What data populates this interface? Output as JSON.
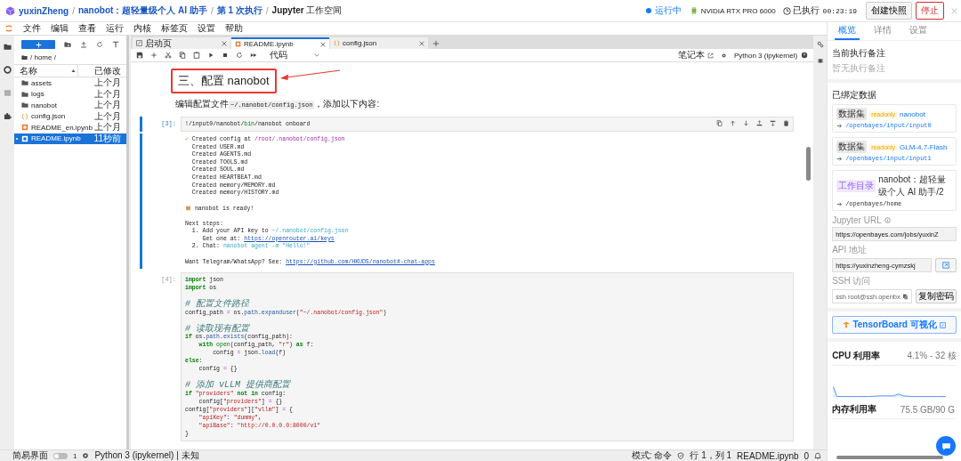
{
  "topbar": {
    "separator": "/",
    "breadcrumbs": [
      {
        "kind": "link",
        "text": "yuxinZheng"
      },
      {
        "kind": "link",
        "text": "nanobot：超轻量级个人 AI 助手"
      },
      {
        "kind": "link",
        "text": "第 1 次执行"
      },
      {
        "kind": "current",
        "text": "**Jupyter** 工作空间"
      }
    ],
    "status": {
      "label": "运行中",
      "running": true
    },
    "gpu": "NVIDIA RTX PRO 6000",
    "elapsed_label": "已执行",
    "elapsed": "00:23:19",
    "buttons": [
      {
        "label": "创建快照",
        "kind": "default"
      },
      {
        "label": "停止",
        "kind": "danger"
      }
    ]
  },
  "menu": [
    "文件",
    "编辑",
    "查看",
    "运行",
    "内核",
    "标签页",
    "设置",
    "帮助"
  ],
  "filebrowser": {
    "path": "/ home /",
    "columns": [
      "名称",
      "已修改"
    ],
    "items": [
      {
        "name": "assets",
        "kind": "folder",
        "modified": "上个月",
        "selected": false,
        "running": false
      },
      {
        "name": "logs",
        "kind": "folder",
        "modified": "上个月",
        "selected": false,
        "running": false
      },
      {
        "name": "nanobot",
        "kind": "folder",
        "modified": "上个月",
        "selected": false,
        "running": false
      },
      {
        "name": "config.json",
        "kind": "json",
        "modified": "上个月",
        "selected": false,
        "running": false
      },
      {
        "name": "README_en.ipynb",
        "kind": "notebook",
        "modified": "上个月",
        "selected": false,
        "running": false
      },
      {
        "name": "README.ipynb",
        "kind": "notebook",
        "modified": "11秒前",
        "selected": true,
        "running": true
      }
    ]
  },
  "notebook": {
    "tabs": [
      {
        "label": "启动页",
        "kind": "launcher",
        "selected": false
      },
      {
        "label": "README.ipynb",
        "kind": "notebook",
        "selected": true
      },
      {
        "label": "config.json",
        "kind": "json",
        "selected": false
      }
    ],
    "cell_type": "代码",
    "notebook_label": "笔记本",
    "kernel": "Python 3 (ipykernel)",
    "cells": [
      {
        "kind": "heading",
        "text": "三、配置 nanobot",
        "highlighted": true
      },
      {
        "kind": "markdown",
        "parts": [
          {
            "kind": "text",
            "text": "编辑配置文件"
          },
          {
            "kind": "code",
            "text": "~/.nanobot/config.json"
          },
          {
            "kind": "text",
            "text": "，添加以下内容:"
          }
        ]
      },
      {
        "kind": "code",
        "prompt": "[3]:",
        "selected": true,
        "lines": [
          {
            "kind": "text",
            "parts": [
              {
                "kind": "plain",
                "text": "!/input0/nanobot/"
              },
              {
                "kind": "builtin",
                "text": "bin"
              },
              {
                "kind": "plain",
                "text": "/nanobot onboard"
              }
            ]
          }
        ],
        "output": [
          {
            "kind": "text",
            "parts": [
              {
                "kind": "check",
                "text": "✓"
              },
              {
                "kind": "plain",
                "text": " Created config at "
              },
              {
                "kind": "path",
                "text": "/root/.nanobot/config.json"
              }
            ]
          },
          {
            "kind": "text",
            "parts": [
              {
                "kind": "plain",
                "text": "  Created USER.md"
              }
            ]
          },
          {
            "kind": "text",
            "parts": [
              {
                "kind": "plain",
                "text": "  Created AGENTS.md"
              }
            ]
          },
          {
            "kind": "text",
            "parts": [
              {
                "kind": "plain",
                "text": "  Created TOOLS.md"
              }
            ]
          },
          {
            "kind": "text",
            "parts": [
              {
                "kind": "plain",
                "text": "  Created SOUL.md"
              }
            ]
          },
          {
            "kind": "text",
            "parts": [
              {
                "kind": "plain",
                "text": "  Created HEARTBEAT.md"
              }
            ]
          },
          {
            "kind": "text",
            "parts": [
              {
                "kind": "plain",
                "text": "  Created memory/MEMORY.md"
              }
            ]
          },
          {
            "kind": "text",
            "parts": [
              {
                "kind": "plain",
                "text": "  Created memory/HISTORY.md"
              }
            ]
          },
          {
            "kind": "blank"
          },
          {
            "kind": "text",
            "parts": [
              {
                "kind": "cat"
              },
              {
                "kind": "plain",
                "text": " nanobot is ready!"
              }
            ]
          },
          {
            "kind": "blank"
          },
          {
            "kind": "text",
            "parts": [
              {
                "kind": "plain",
                "text": "Next steps:"
              }
            ]
          },
          {
            "kind": "text",
            "parts": [
              {
                "kind": "plain",
                "text": "  1. Add your API key to "
              },
              {
                "kind": "cyan",
                "text": "~/.nanobot/config.json"
              }
            ]
          },
          {
            "kind": "text",
            "parts": [
              {
                "kind": "plain",
                "text": "     Get one at: "
              },
              {
                "kind": "link",
                "text": "https://openrouter.ai/keys"
              }
            ]
          },
          {
            "kind": "text",
            "parts": [
              {
                "kind": "plain",
                "text": "  2. Chat: "
              },
              {
                "kind": "cyan",
                "text": "nanobot agent -m \"Hello!\""
              }
            ]
          },
          {
            "kind": "blank"
          },
          {
            "kind": "text",
            "parts": [
              {
                "kind": "plain",
                "text": "Want Telegram/WhatsApp? See: "
              },
              {
                "kind": "link",
                "text": "https://github.com/HKUDS/nanobot#-chat-apps"
              }
            ]
          }
        ]
      },
      {
        "kind": "code",
        "prompt": "[4]:",
        "selected": false,
        "lines": [
          {
            "kind": "text",
            "parts": [
              {
                "kind": "keyword",
                "text": "import"
              },
              {
                "kind": "plain",
                "text": " json"
              }
            ]
          },
          {
            "kind": "text",
            "parts": [
              {
                "kind": "keyword",
                "text": "import"
              },
              {
                "kind": "plain",
                "text": " os"
              }
            ]
          },
          {
            "kind": "blank"
          },
          {
            "kind": "text",
            "parts": [
              {
                "kind": "comment",
                "text": "# 配置文件路径"
              }
            ]
          },
          {
            "kind": "text",
            "parts": [
              {
                "kind": "plain",
                "text": "config_path "
              },
              {
                "kind": "op",
                "text": "="
              },
              {
                "kind": "plain",
                "text": " os."
              },
              {
                "kind": "attr",
                "text": "path"
              },
              {
                "kind": "plain",
                "text": "."
              },
              {
                "kind": "attr",
                "text": "expanduser"
              },
              {
                "kind": "plain",
                "text": "("
              },
              {
                "kind": "string",
                "text": "\"~/.nanobot/config.json\""
              },
              {
                "kind": "plain",
                "text": ")"
              }
            ]
          },
          {
            "kind": "blank"
          },
          {
            "kind": "text",
            "parts": [
              {
                "kind": "comment",
                "text": "# 读取现有配置"
              }
            ]
          },
          {
            "kind": "text",
            "parts": [
              {
                "kind": "keyword",
                "text": "if"
              },
              {
                "kind": "plain",
                "text": " os."
              },
              {
                "kind": "attr",
                "text": "path"
              },
              {
                "kind": "plain",
                "text": "."
              },
              {
                "kind": "attr",
                "text": "exists"
              },
              {
                "kind": "plain",
                "text": "(config_path):"
              }
            ]
          },
          {
            "kind": "text",
            "parts": [
              {
                "kind": "keyword",
                "text": "    with"
              },
              {
                "kind": "builtin",
                "text": " open"
              },
              {
                "kind": "plain",
                "text": "(config_path, "
              },
              {
                "kind": "string",
                "text": "\"r\""
              },
              {
                "kind": "plain",
                "text": ") "
              },
              {
                "kind": "keyword",
                "text": "as"
              },
              {
                "kind": "plain",
                "text": " f:"
              }
            ]
          },
          {
            "kind": "text",
            "parts": [
              {
                "kind": "plain",
                "text": "        config "
              },
              {
                "kind": "op",
                "text": "="
              },
              {
                "kind": "plain",
                "text": " json."
              },
              {
                "kind": "attr",
                "text": "load"
              },
              {
                "kind": "plain",
                "text": "(f)"
              }
            ]
          },
          {
            "kind": "text",
            "parts": [
              {
                "kind": "keyword",
                "text": "else"
              },
              {
                "kind": "plain",
                "text": ":"
              }
            ]
          },
          {
            "kind": "text",
            "parts": [
              {
                "kind": "plain",
                "text": "    config "
              },
              {
                "kind": "op",
                "text": "="
              },
              {
                "kind": "plain",
                "text": " {}"
              }
            ]
          },
          {
            "kind": "blank"
          },
          {
            "kind": "text",
            "parts": [
              {
                "kind": "comment",
                "text": "# 添加 vLLM 提供商配置"
              }
            ]
          },
          {
            "kind": "text",
            "parts": [
              {
                "kind": "keyword",
                "text": "if"
              },
              {
                "kind": "string",
                "text": " \"providers\""
              },
              {
                "kind": "keyword",
                "text": " not in"
              },
              {
                "kind": "plain",
                "text": " config:"
              }
            ]
          },
          {
            "kind": "text",
            "parts": [
              {
                "kind": "plain",
                "text": "    config["
              },
              {
                "kind": "string",
                "text": "\"providers\""
              },
              {
                "kind": "plain",
                "text": "] "
              },
              {
                "kind": "op",
                "text": "="
              },
              {
                "kind": "plain",
                "text": " {}"
              }
            ]
          },
          {
            "kind": "text",
            "parts": [
              {
                "kind": "plain",
                "text": "config["
              },
              {
                "kind": "string",
                "text": "\"providers\""
              },
              {
                "kind": "plain",
                "text": "]["
              },
              {
                "kind": "string",
                "text": "\"vllm\""
              },
              {
                "kind": "plain",
                "text": "] "
              },
              {
                "kind": "op",
                "text": "="
              },
              {
                "kind": "plain",
                "text": " {"
              }
            ]
          },
          {
            "kind": "text",
            "parts": [
              {
                "kind": "string",
                "text": "    \"apiKey\""
              },
              {
                "kind": "plain",
                "text": ": "
              },
              {
                "kind": "string",
                "text": "\"dummy\""
              },
              {
                "kind": "plain",
                "text": ","
              }
            ]
          },
          {
            "kind": "text",
            "parts": [
              {
                "kind": "string",
                "text": "    \"apiBase\""
              },
              {
                "kind": "plain",
                "text": ": "
              },
              {
                "kind": "string",
                "text": "\"http://0.0.0.0:8000/v1\""
              }
            ]
          },
          {
            "kind": "text",
            "parts": [
              {
                "kind": "plain",
                "text": "}"
              }
            ]
          }
        ]
      }
    ]
  },
  "status_bar": {
    "simple_mode": {
      "label": "简易界面",
      "on": false
    },
    "terminals": "1",
    "kernel": "Python 3 (ipykernel) | 未知",
    "mode": "模式: 命令",
    "position": "行 1，列 1",
    "file": "README.ipynb",
    "notifications": "0"
  },
  "panel": {
    "tabs": [
      {
        "label": "概览",
        "selected": true
      },
      {
        "label": "详情",
        "selected": false
      },
      {
        "label": "设置",
        "selected": false
      }
    ],
    "note": {
      "title": "当前执行备注",
      "text": "暂无执行备注"
    },
    "bound": {
      "title": "已绑定数据",
      "items": [
        {
          "kind": "dataset",
          "tag": "数据集",
          "badge": "readonly",
          "name": "nanobot",
          "path": "/openbayes/input/input0"
        },
        {
          "kind": "dataset",
          "tag": "数据集",
          "badge": "readonly",
          "name": "GLM-4.7-Flash",
          "path": "/openbayes/input/input1"
        },
        {
          "kind": "workdir",
          "tag": "工作目录",
          "name": "nanobot：超轻量级个人 AI 助手/2",
          "path": "/openbayes/home"
        }
      ]
    },
    "access": [
      {
        "kind": "url",
        "label": "Jupyter URL",
        "value": "https://openbayes.com/jobs/yuxinZ"
      },
      {
        "kind": "open",
        "label": "API 地址",
        "value": "https://yuxinzheng-cymzskj"
      },
      {
        "kind": "ssh",
        "label": "SSH 访问",
        "value": "ssh root@ssh.openbx",
        "button": "复制密码"
      }
    ],
    "tensorboard": "TensorBoard 可视化",
    "cpu": {
      "title": "CPU 利用率",
      "reading": "4.1% - 32 核"
    },
    "memory": {
      "title": "内存利用率",
      "reading": "75.5 GB/90 G"
    }
  }
}
